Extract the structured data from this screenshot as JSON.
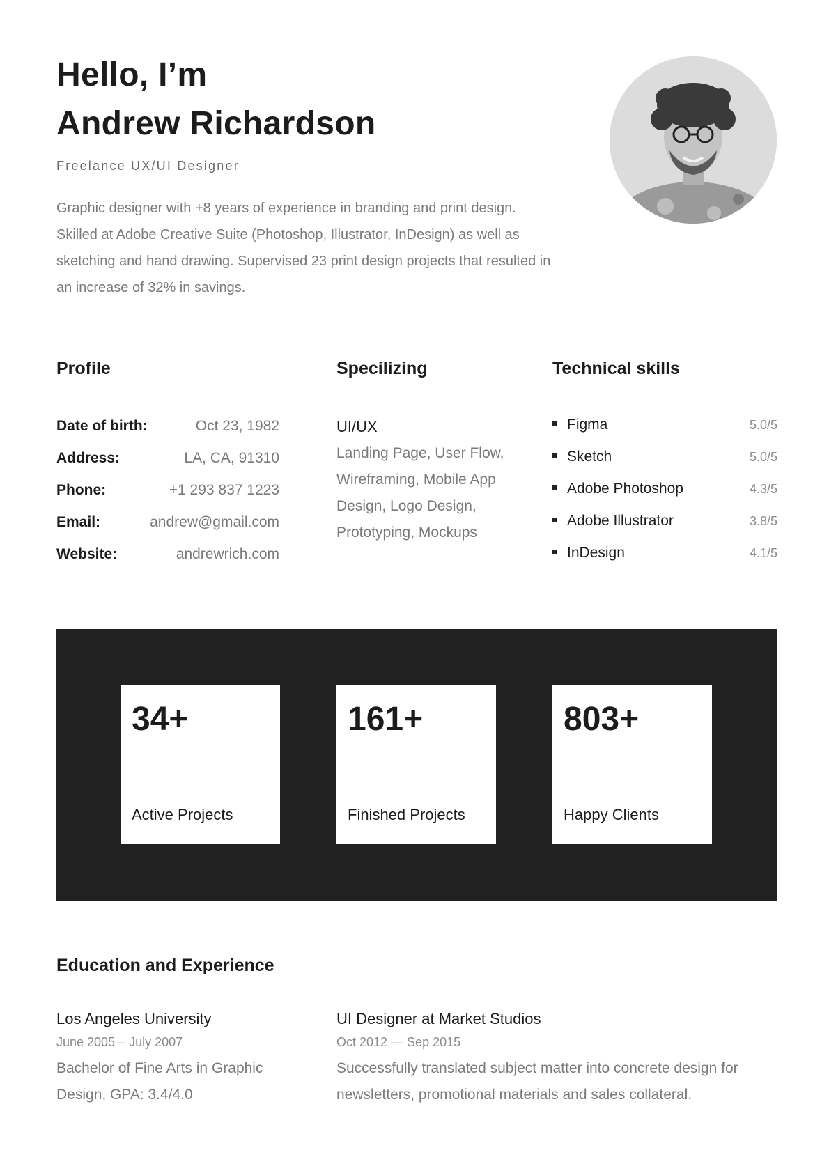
{
  "header": {
    "greeting": "Hello, I’m",
    "name": "Andrew Richardson",
    "role": "Freelance UX/UI Designer",
    "summary": "Graphic designer with +8 years of experience in branding and print design. Skilled at Adobe Creative Suite (Photoshop, Illustrator, InDesign) as well as sketching and hand drawing. Supervised 23 print design projects that resulted in an increase of 32% in savings."
  },
  "profile": {
    "heading": "Profile",
    "rows": [
      {
        "label": "Date of birth:",
        "value": "Oct 23, 1982"
      },
      {
        "label": "Address:",
        "value": "LA, CA, 91310"
      },
      {
        "label": "Phone:",
        "value": "+1 293 837 1223"
      },
      {
        "label": "Email:",
        "value": "andrew@gmail.com"
      },
      {
        "label": "Website:",
        "value": "andrewrich.com"
      }
    ]
  },
  "specializing": {
    "heading": "Specilizing",
    "title": "UI/UX",
    "text": "Landing Page, User Flow, Wireframing, Mobile App Design, Logo Design, Prototyping, Mockups"
  },
  "skills": {
    "heading": "Technical skills",
    "items": [
      {
        "name": "Figma",
        "score": "5.0/5"
      },
      {
        "name": "Sketch",
        "score": "5.0/5"
      },
      {
        "name": "Adobe Photoshop",
        "score": "4.3/5"
      },
      {
        "name": "Adobe Illustrator",
        "score": "3.8/5"
      },
      {
        "name": "InDesign",
        "score": "4.1/5"
      }
    ]
  },
  "stats": [
    {
      "number": "34+",
      "label": "Active Projects"
    },
    {
      "number": "161+",
      "label": "Finished Projects"
    },
    {
      "number": "803+",
      "label": "Happy Clients"
    }
  ],
  "education": {
    "heading": "Education and Experience",
    "entries": [
      {
        "title": "Los Angeles University",
        "date": "June 2005 – July 2007",
        "desc": "Bachelor of Fine Arts in Graphic Design, GPA: 3.4/4.0"
      },
      {
        "title": "UI Designer at Market Studios",
        "date": "Oct 2012 — Sep 2015",
        "desc": "Successfully translated subject matter into concrete design for newsletters, promotional materials and sales collateral."
      }
    ]
  },
  "colors": {
    "text_dark": "#1c1c1c",
    "text_muted": "#7a7a7a",
    "stats_background": "#212121",
    "card_background": "#ffffff"
  }
}
